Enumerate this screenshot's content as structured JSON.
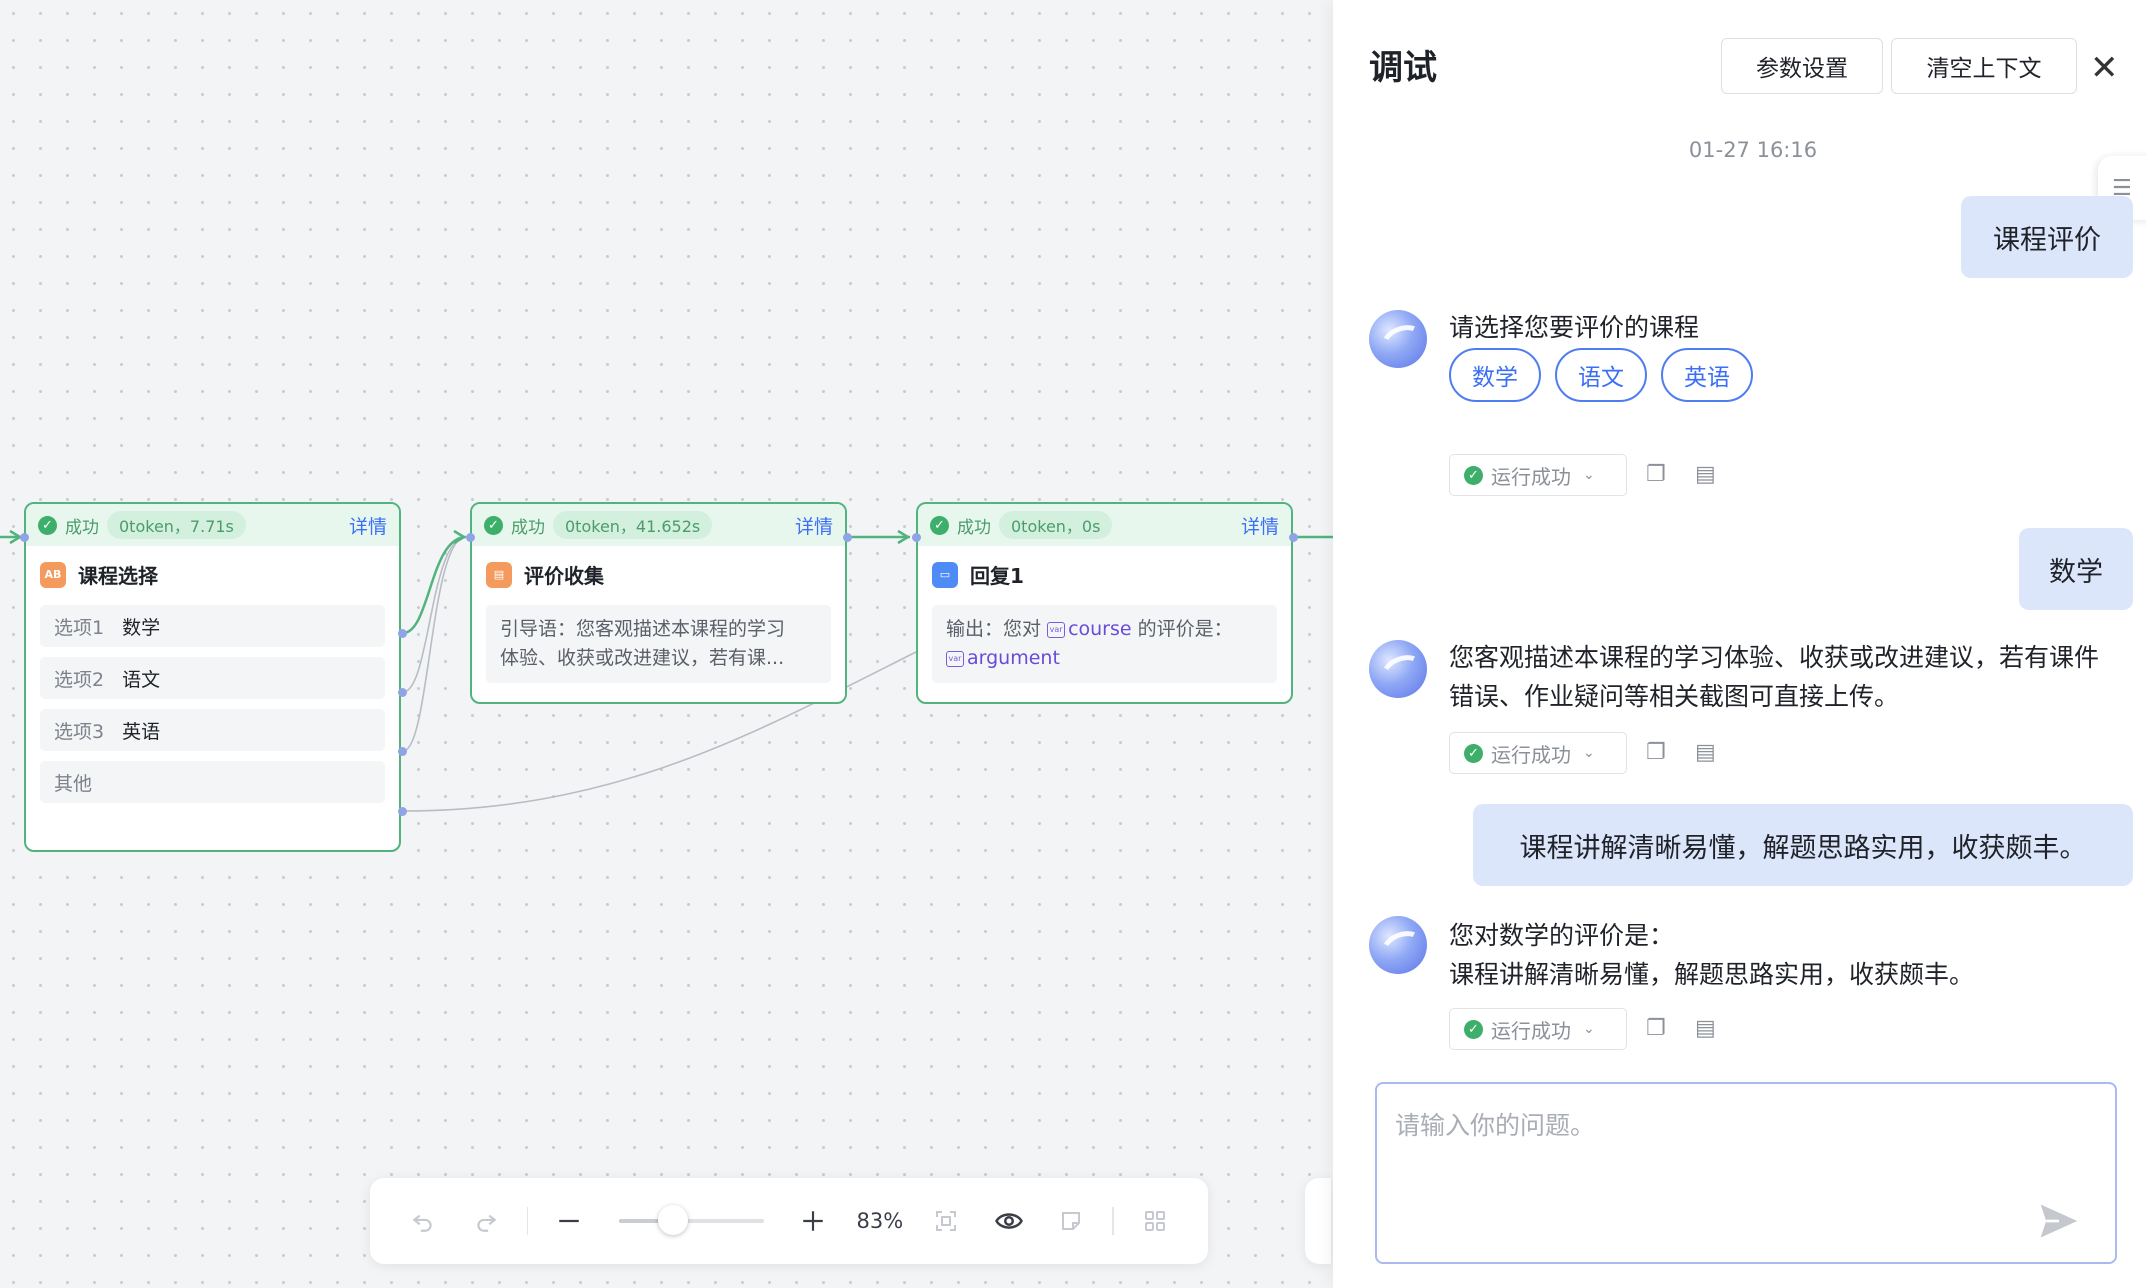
{
  "canvas": {
    "nodes": [
      {
        "id": "course-select",
        "status": "成功",
        "metric": "0token，7.71s",
        "detail": "详情",
        "title": "课程选择",
        "icon": "ab-icon",
        "options": [
          {
            "key": "选项1",
            "value": "数学"
          },
          {
            "key": "选项2",
            "value": "语文"
          },
          {
            "key": "选项3",
            "value": "英语"
          },
          {
            "key": "其他",
            "value": ""
          }
        ]
      },
      {
        "id": "review-collect",
        "status": "成功",
        "metric": "0token，41.652s",
        "detail": "详情",
        "title": "评价收集",
        "icon": "form-icon",
        "text_line1": "引导语：您客观描述本课程的学习",
        "text_line2": "体验、收获或改进建议，若有课..."
      },
      {
        "id": "reply1",
        "status": "成功",
        "metric": "0token，0s",
        "detail": "详情",
        "title": "回复1",
        "icon": "chat-icon",
        "out_prefix": "输出：您对",
        "var1": "course",
        "out_mid": "的评价是：",
        "var2": "argument",
        "var_icon_text": "var"
      }
    ]
  },
  "toolbar": {
    "zoom": "83%",
    "zoom_fraction": 0.36,
    "undo_icon": "undo-icon",
    "redo_icon": "redo-icon",
    "zoom_out_icon": "minus-icon",
    "zoom_in_icon": "plus-icon",
    "fit_icon": "fit-view-icon",
    "preview_icon": "eye-icon",
    "note_icon": "sticky-note-icon",
    "layout_icon": "grid-icon"
  },
  "panel": {
    "title": "调试",
    "params_button": "参数设置",
    "clear_button": "清空上下文",
    "timestamp": "01-27 16:16",
    "input_placeholder": "请输入你的问题。",
    "run_status": "运行成功",
    "messages": [
      {
        "role": "user",
        "text": "课程评价"
      },
      {
        "role": "bot",
        "text": "请选择您要评价的课程",
        "options": [
          "数学",
          "语文",
          "英语"
        ]
      },
      {
        "role": "user",
        "text": "数学"
      },
      {
        "role": "bot",
        "line1": "您客观描述本课程的学习体验、收获或改进建议，若有课件",
        "line2": "错误、作业疑问等相关截图可直接上传。"
      },
      {
        "role": "user",
        "text": "课程讲解清晰易懂，解题思路实用，收获颇丰。"
      },
      {
        "role": "bot",
        "line1": "您对数学的评价是：",
        "line2": "课程讲解清晰易懂，解题思路实用，收获颇丰。"
      }
    ]
  },
  "colors": {
    "accent": "#3b6ff5",
    "success": "#3eaf6a",
    "node_border": "#52b37e",
    "user_bubble": "#dce6fb"
  }
}
